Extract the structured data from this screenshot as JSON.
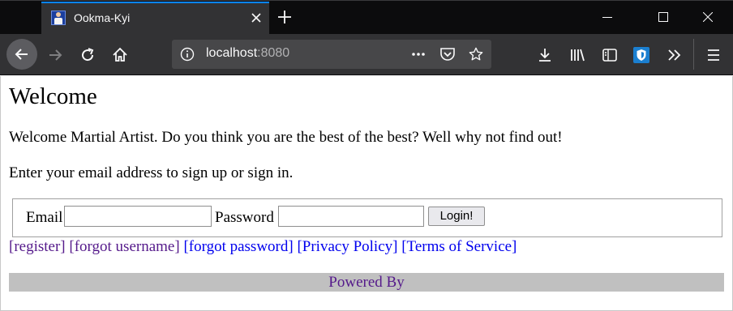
{
  "browser": {
    "tab_title": "Ookma-Kyi",
    "url_host": "localhost",
    "url_port": ":8080"
  },
  "page": {
    "title": "Welcome",
    "intro": "Welcome Martial Artist. Do you think you are the best of the best? Well why not find out!",
    "instructions": "Enter your email address to sign up or sign in.",
    "form": {
      "email_label": "Email",
      "email_value": "",
      "password_label": "Password",
      "password_value": "",
      "submit_label": "Login!"
    },
    "links": [
      {
        "label": "[register]",
        "visited": true
      },
      {
        "label": "[forgot username]",
        "visited": true
      },
      {
        "label": "[forgot password]",
        "visited": false
      },
      {
        "label": "[Privacy Policy]",
        "visited": false
      },
      {
        "label": "[Terms of Service]",
        "visited": false
      }
    ],
    "footer": "Powered By"
  },
  "colors": {
    "accent": "#0a84ff",
    "link": "#0000ee",
    "visited_link": "#551a8b",
    "footer_bg": "#c0c0c0"
  }
}
